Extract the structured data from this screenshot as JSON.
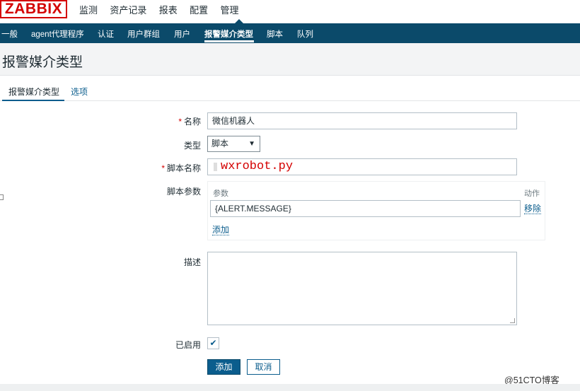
{
  "logo": {
    "text": "ZABBIX",
    "color": "#d40000"
  },
  "main_menu": [
    "监测",
    "资产记录",
    "报表",
    "配置",
    "管理"
  ],
  "sub_nav": {
    "items": [
      "一般",
      "agent代理程序",
      "认证",
      "用户群组",
      "用户",
      "报警媒介类型",
      "脚本",
      "队列"
    ],
    "active": "报警媒介类型",
    "background": "#0b4a6a"
  },
  "page": {
    "title": "报警媒介类型"
  },
  "tabs": {
    "active": "报警媒介类型",
    "other": "选项"
  },
  "form": {
    "name_label": "名称",
    "name_value": "微信机器人",
    "type_label": "类型",
    "type_value": "脚本",
    "script_name_label": "脚本名称",
    "script_name_value": "wxrobot.py",
    "script_params_label": "脚本参数",
    "params_header": "参数",
    "params_action_header": "动作",
    "param_value": "{ALERT.MESSAGE}",
    "remove_link": "移除",
    "add_link": "添加",
    "description_label": "描述",
    "enabled_label": "已启用",
    "enabled_checked": true,
    "required_mark": "*",
    "dropdown_arrow": "▼",
    "check_mark": "✔"
  },
  "buttons": {
    "add": "添加",
    "cancel": "取消"
  },
  "watermark": "@51CTO博客",
  "accent_color": "#0b5d8d"
}
